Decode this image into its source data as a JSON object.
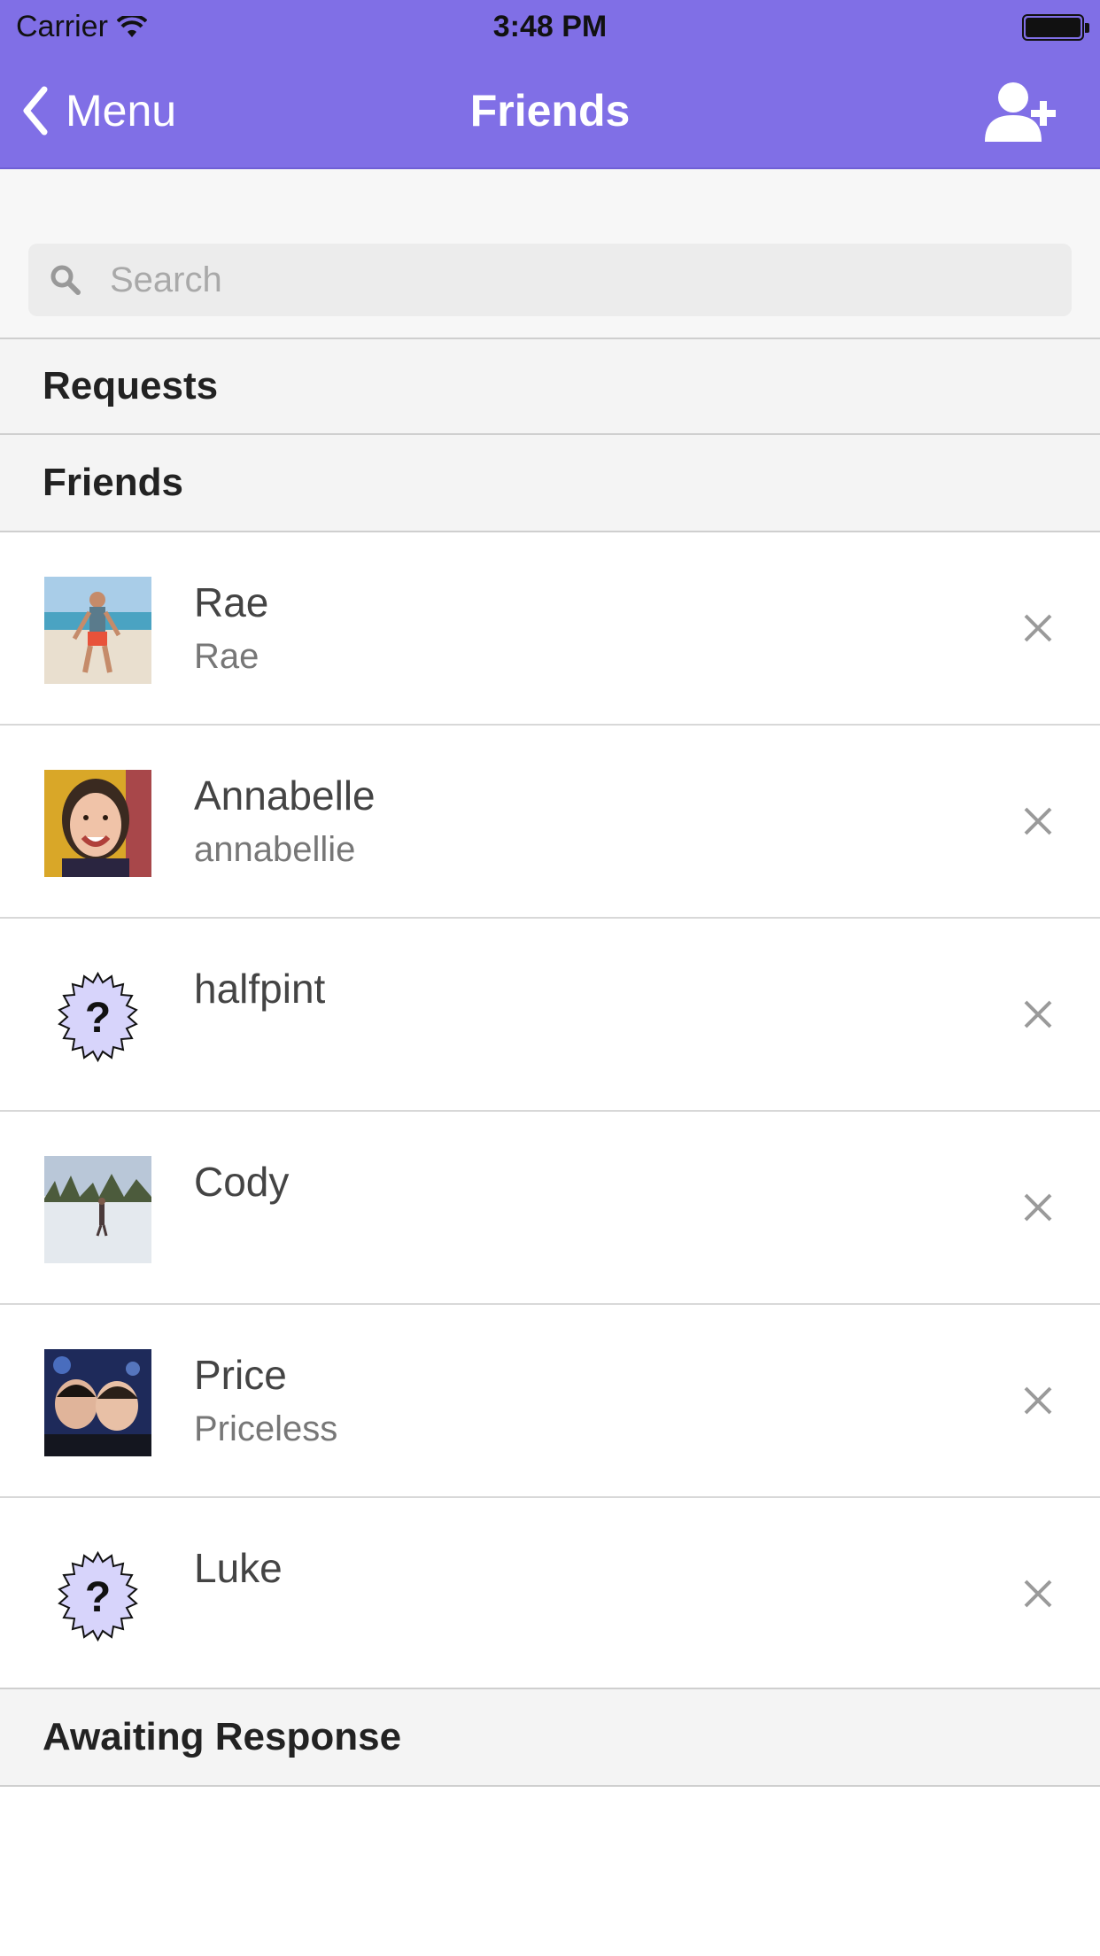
{
  "status_bar": {
    "carrier": "Carrier",
    "time": "3:48 PM"
  },
  "nav": {
    "back_label": "Menu",
    "title": "Friends",
    "add_icon": "add-friend-icon",
    "color": "#806fe6"
  },
  "search": {
    "placeholder": "Search",
    "value": ""
  },
  "sections": {
    "requests": "Requests",
    "friends": "Friends",
    "awaiting": "Awaiting Response"
  },
  "friends": [
    {
      "name": "Rae",
      "username": "Rae",
      "avatar": "photo-beach"
    },
    {
      "name": "Annabelle",
      "username": "annabellie",
      "avatar": "photo-selfie"
    },
    {
      "name": "halfpint",
      "username": "",
      "avatar": "unknown-user-icon"
    },
    {
      "name": "Cody",
      "username": "",
      "avatar": "photo-skating"
    },
    {
      "name": "Price",
      "username": "Priceless",
      "avatar": "photo-group"
    },
    {
      "name": "Luke",
      "username": "",
      "avatar": "unknown-user-icon"
    }
  ]
}
